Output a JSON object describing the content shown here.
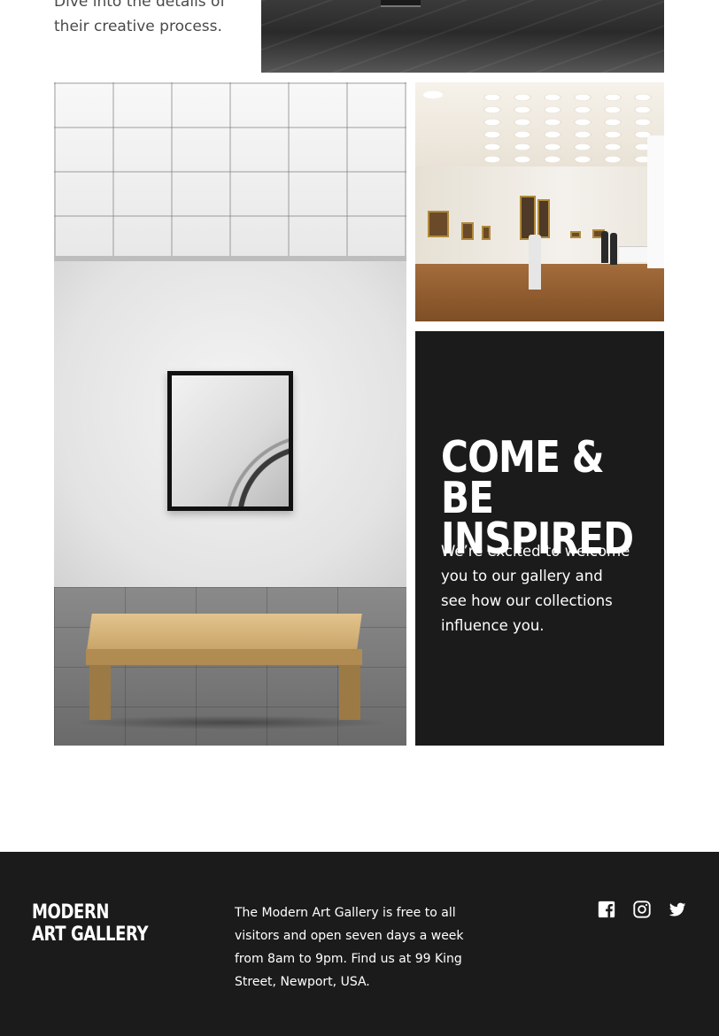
{
  "intro": {
    "text": "Dive into the details of their creative process."
  },
  "gallery": {
    "top_photo": "gallery-floor-photo",
    "large_photo": "white-room-bench-photo",
    "museum_photo": "museum-hall-photo"
  },
  "inspire": {
    "heading": "Come & be inspired",
    "body": "We’re excited to welcome you to our gallery and see how our collections influence you."
  },
  "footer": {
    "logo_line1": "MODERN",
    "logo_line2": "ART GALLERY",
    "info": "The Modern Art Gallery is free to all visitors and open seven days a week from 8am to 9pm. Find us at 99 King Street, Newport, USA.",
    "socials": [
      "facebook-icon",
      "instagram-icon",
      "twitter-icon"
    ]
  },
  "colors": {
    "dark": "#1b1b1b",
    "text_muted": "#4a4a4a",
    "white": "#ffffff"
  }
}
